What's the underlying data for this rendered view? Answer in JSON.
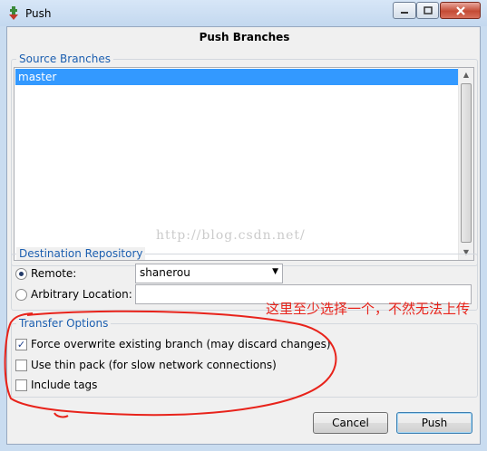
{
  "window": {
    "title": "Push",
    "controls": [
      "minimize",
      "maximize",
      "close"
    ]
  },
  "dialog": {
    "heading": "Push Branches"
  },
  "source_branches": {
    "legend": "Source Branches",
    "items": [
      {
        "label": "master",
        "selected": true
      }
    ]
  },
  "destination": {
    "legend": "Destination Repository",
    "remote_label": "Remote:",
    "remote_selected": true,
    "remote_value": "shanerou",
    "arbitrary_label": "Arbitrary Location:",
    "arbitrary_value": ""
  },
  "transfer_options": {
    "legend": "Transfer Options",
    "options": [
      {
        "label": "Force overwrite existing branch (may discard changes)",
        "checked": true
      },
      {
        "label": "Use thin pack (for slow network connections)",
        "checked": false
      },
      {
        "label": "Include tags",
        "checked": false
      }
    ]
  },
  "buttons": {
    "cancel": "Cancel",
    "push": "Push"
  },
  "watermark": "http://blog.csdn.net/",
  "annotation": {
    "text": "这里至少选择一个，不然无法上传",
    "color": "#e8231b"
  },
  "colors": {
    "accent": "#1c5fb0",
    "selection": "#3399ff"
  }
}
